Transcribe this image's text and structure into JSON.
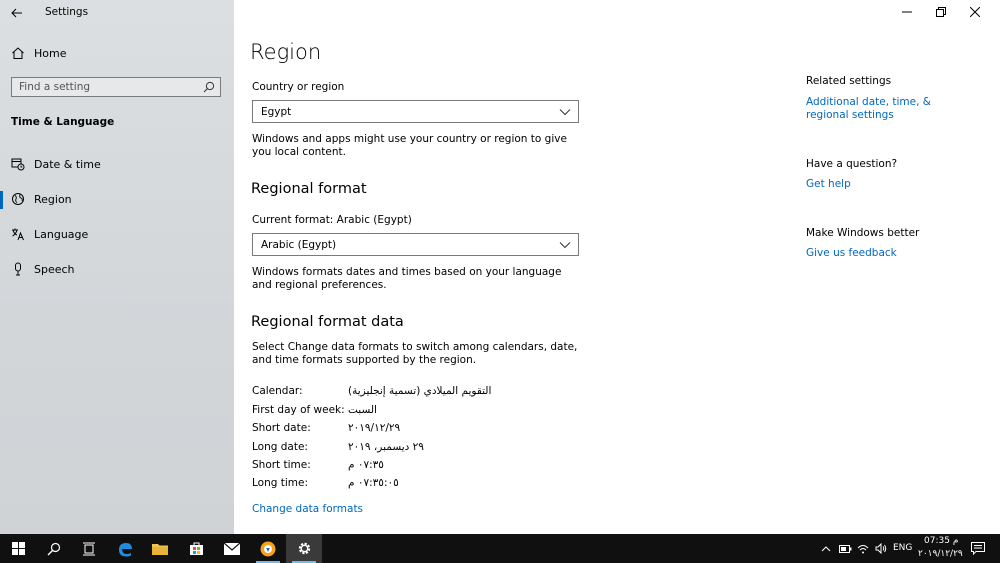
{
  "app": {
    "title": "Settings"
  },
  "sidebar": {
    "home_label": "Home",
    "search_placeholder": "Find a setting",
    "section_heading": "Time & Language",
    "items": [
      {
        "label": "Date & time",
        "icon": "clock-calendar-icon",
        "selected": false
      },
      {
        "label": "Region",
        "icon": "globe-icon",
        "selected": true
      },
      {
        "label": "Language",
        "icon": "language-icon",
        "selected": false
      },
      {
        "label": "Speech",
        "icon": "microphone-icon",
        "selected": false
      }
    ]
  },
  "main": {
    "title": "Region",
    "country": {
      "label": "Country or region",
      "value": "Egypt",
      "description": "Windows and apps might use your country or region to give you local content."
    },
    "regional_format": {
      "heading": "Regional format",
      "current_label": "Current format: Arabic (Egypt)",
      "value": "Arabic (Egypt)",
      "description": "Windows formats dates and times based on your language and regional preferences."
    },
    "format_data": {
      "heading": "Regional format data",
      "description": "Select Change data formats to switch among calendars, date, and time formats supported by the region.",
      "rows": [
        {
          "key": "Calendar:",
          "value": "التقويم الميلادي (تسمية إنجليزية)"
        },
        {
          "key": "First day of week:",
          "value": "السبت"
        },
        {
          "key": "Short date:",
          "value": "٢٠١٩/١٢/٢٩"
        },
        {
          "key": "Long date:",
          "value": "٢٩ ديسمبر، ٢٠١٩"
        },
        {
          "key": "Short time:",
          "value": "٠٧:٣٥ م"
        },
        {
          "key": "Long time:",
          "value": "٠٧:٣٥:٠٥ م"
        }
      ],
      "change_link": "Change data formats"
    }
  },
  "right": {
    "related_heading": "Related settings",
    "related_link": "Additional date, time, & regional settings",
    "question_heading": "Have a question?",
    "help_link": "Get help",
    "better_heading": "Make Windows better",
    "feedback_link": "Give us feedback"
  },
  "taskbar": {
    "lang": "ENG",
    "time": "07:35 م",
    "date": "٢٠١٩/١٢/٢٩",
    "accent": "#76b9ed"
  },
  "colors": {
    "link": "#0067c0",
    "accent": "#0067c0"
  }
}
